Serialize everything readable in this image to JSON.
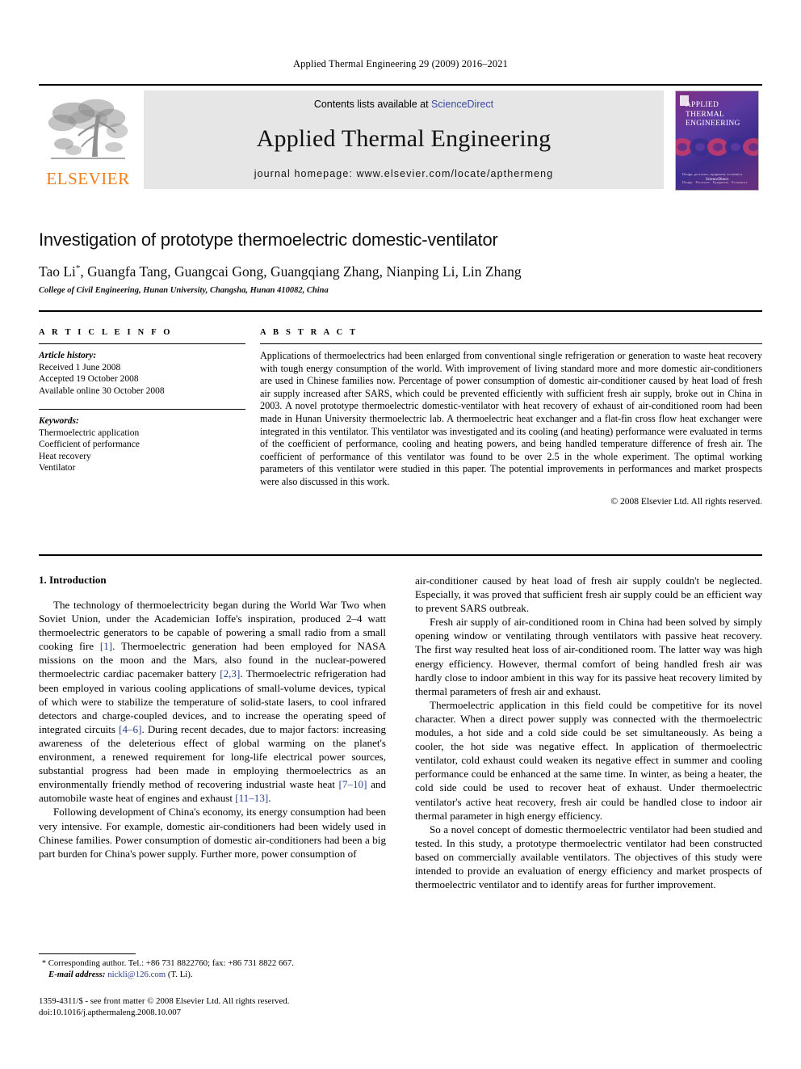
{
  "running_head": "Applied Thermal Engineering 29 (2009) 2016–2021",
  "masthead": {
    "publisher_logo_text": "ELSEVIER",
    "contents_prefix": "Contents lists available at ",
    "contents_link": "ScienceDirect",
    "journal_name": "Applied Thermal Engineering",
    "homepage": "journal homepage: www.elsevier.com/locate/apthermeng",
    "cover": {
      "line1": "APPLIED",
      "line2": "THERMAL",
      "line3": "ENGINEERING",
      "footer1": "Design, processes, equipment, economics",
      "footer2": "Design · Processes · Equipment · Economics",
      "sciencedirect": "ScienceDirect"
    }
  },
  "article": {
    "title": "Investigation of prototype thermoelectric domestic-ventilator",
    "authors": "Tao Li*, Guangfa Tang, Guangcai Gong, Guangqiang Zhang, Nianping Li, Lin Zhang",
    "affiliation": "College of Civil Engineering, Hunan University, Changsha, Hunan 410082, China"
  },
  "info": {
    "heading": "A R T I C L E   I N F O",
    "history_label": "Article history:",
    "history": [
      "Received 1 June 2008",
      "Accepted 19 October 2008",
      "Available online 30 October 2008"
    ],
    "keywords_label": "Keywords:",
    "keywords": [
      "Thermoelectric application",
      "Coefficient of performance",
      "Heat recovery",
      "Ventilator"
    ]
  },
  "abstract": {
    "heading": "A B S T R A C T",
    "text": "Applications of thermoelectrics had been enlarged from conventional single refrigeration or generation to waste heat recovery with tough energy consumption of the world. With improvement of living standard more and more domestic air-conditioners are used in Chinese families now. Percentage of power consumption of domestic air-conditioner caused by heat load of fresh air supply increased after SARS, which could be prevented efficiently with sufficient fresh air supply, broke out in China in 2003. A novel prototype thermoelectric domestic-ventilator with heat recovery of exhaust of air-conditioned room had been made in Hunan University thermoelectric lab. A thermoelectric heat exchanger and a flat-fin cross flow heat exchanger were integrated in this ventilator. This ventilator was investigated and its cooling (and heating) performance were evaluated in terms of the coefficient of performance, cooling and heating powers, and being handled temperature difference of fresh air. The coefficient of performance of this ventilator was found to be over 2.5 in the whole experiment. The optimal working parameters of this ventilator were studied in this paper. The potential improvements in performances and market prospects were also discussed in this work.",
    "copyright": "© 2008 Elsevier Ltd. All rights reserved."
  },
  "body": {
    "section_heading": "1. Introduction",
    "left_paragraphs": [
      "The technology of thermoelectricity began during the World War Two when Soviet Union, under the Academician Ioffe's inspiration, produced 2–4 watt thermoelectric generators to be capable of powering a small radio from a small cooking fire [1]. Thermoelectric generation had been employed for NASA missions on the moon and the Mars, also found in the nuclear-powered thermoelectric cardiac pacemaker battery [2,3]. Thermoelectric refrigeration had been employed in various cooling applications of small-volume devices, typical of which were to stabilize the temperature of solid-state lasers, to cool infrared detectors and charge-coupled devices, and to increase the operating speed of integrated circuits [4–6]. During recent decades, due to major factors: increasing awareness of the deleterious effect of global warming on the planet's environment, a renewed requirement for long-life electrical power sources, substantial progress had been made in employing thermoelectrics as an environmentally friendly method of recovering industrial waste heat [7–10] and automobile waste heat of engines and exhaust [11–13].",
      "Following development of China's economy, its energy consumption had been very intensive. For example, domestic air-conditioners had been widely used in Chinese families. Power consumption of domestic air-conditioners had been a big part burden for China's power supply. Further more, power consumption of"
    ],
    "right_paragraphs": [
      "air-conditioner caused by heat load of fresh air supply couldn't be neglected. Especially, it was proved that sufficient fresh air supply could be an efficient way to prevent SARS outbreak.",
      "Fresh air supply of air-conditioned room in China had been solved by simply opening window or ventilating through ventilators with passive heat recovery. The first way resulted heat loss of air-conditioned room. The latter way was high energy efficiency. However, thermal comfort of being handled fresh air was hardly close to indoor ambient in this way for its passive heat recovery limited by thermal parameters of fresh air and exhaust.",
      "Thermoelectric application in this field could be competitive for its novel character. When a direct power supply was connected with the thermoelectric modules, a hot side and a cold side could be set simultaneously. As being a cooler, the hot side was negative effect. In application of thermoelectric ventilator, cold exhaust could weaken its negative effect in summer and cooling performance could be enhanced at the same time. In winter, as being a heater, the cold side could be used to recover heat of exhaust. Under thermoelectric ventilator's active heat recovery, fresh air could be handled close to indoor air thermal parameter in high energy efficiency.",
      "So a novel concept of domestic thermoelectric ventilator had been studied and tested. In this study, a prototype thermoelectric ventilator had been constructed based on commercially available ventilators. The objectives of this study were intended to provide an evaluation of energy efficiency and market prospects of thermoelectric ventilator and to identify areas for further improvement."
    ]
  },
  "footnote": {
    "star": "*",
    "line1": "Corresponding author. Tel.: +86 731 8822760; fax: +86 731 8822 667.",
    "email_label": "E-mail address:",
    "email": "nickli@126.com",
    "email_suffix": "(T. Li)."
  },
  "issn_footer": {
    "line1": "1359-4311/$ - see front matter © 2008 Elsevier Ltd. All rights reserved.",
    "line2": "doi:10.1016/j.apthermaleng.2008.10.007"
  },
  "colors": {
    "link": "#2b3f8c",
    "elsevier_orange": "#f07d16",
    "masthead_grey": "#e6e6e6"
  }
}
